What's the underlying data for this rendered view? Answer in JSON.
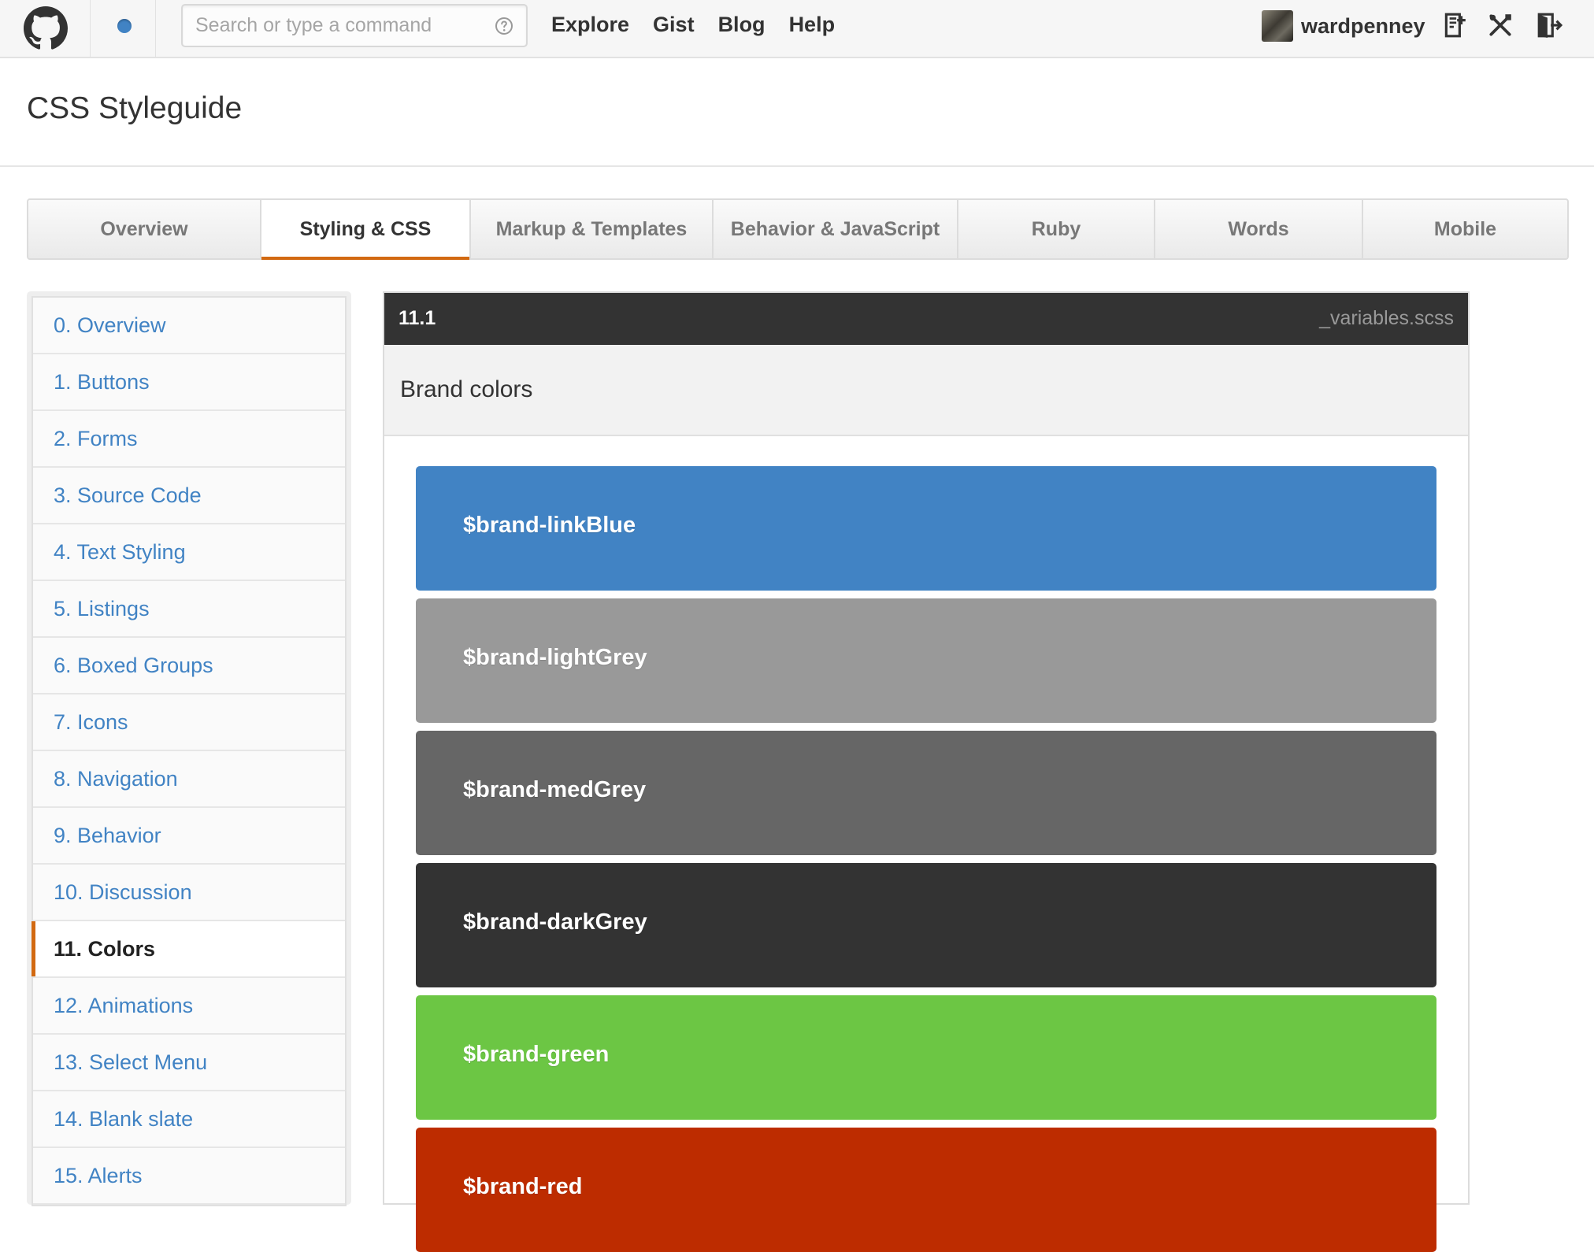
{
  "header": {
    "search_placeholder": "Search or type a command",
    "nav": [
      "Explore",
      "Gist",
      "Blog",
      "Help"
    ],
    "username": "wardpenney"
  },
  "page": {
    "title": "CSS Styleguide"
  },
  "tabs": [
    {
      "label": "Overview",
      "selected": false
    },
    {
      "label": "Styling & CSS",
      "selected": true
    },
    {
      "label": "Markup & Templates",
      "selected": false
    },
    {
      "label": "Behavior & JavaScript",
      "selected": false
    },
    {
      "label": "Ruby",
      "selected": false
    },
    {
      "label": "Words",
      "selected": false
    },
    {
      "label": "Mobile",
      "selected": false
    }
  ],
  "sidebar": {
    "items": [
      {
        "label": "0. Overview"
      },
      {
        "label": "1. Buttons"
      },
      {
        "label": "2. Forms"
      },
      {
        "label": "3. Source Code"
      },
      {
        "label": "4. Text Styling"
      },
      {
        "label": "5. Listings"
      },
      {
        "label": "6. Boxed Groups"
      },
      {
        "label": "7. Icons"
      },
      {
        "label": "8. Navigation"
      },
      {
        "label": "9. Behavior"
      },
      {
        "label": "10. Discussion"
      },
      {
        "label": "11. Colors",
        "selected": true
      },
      {
        "label": "12. Animations"
      },
      {
        "label": "13. Select Menu"
      },
      {
        "label": "14. Blank slate"
      },
      {
        "label": "15. Alerts"
      }
    ]
  },
  "main": {
    "section_number": "11.1",
    "file_name": "_variables.scss",
    "subtitle": "Brand colors",
    "swatches": [
      {
        "label": "$brand-linkBlue",
        "color": "#4183c4"
      },
      {
        "label": "$brand-lightGrey",
        "color": "#999999"
      },
      {
        "label": "$brand-medGrey",
        "color": "#666666"
      },
      {
        "label": "$brand-darkGrey",
        "color": "#333333"
      },
      {
        "label": "$brand-green",
        "color": "#6cc644"
      },
      {
        "label": "$brand-red",
        "color": "#bd2c00"
      }
    ]
  },
  "colors": {
    "accent": "#d26911",
    "link": "#4183c4"
  }
}
